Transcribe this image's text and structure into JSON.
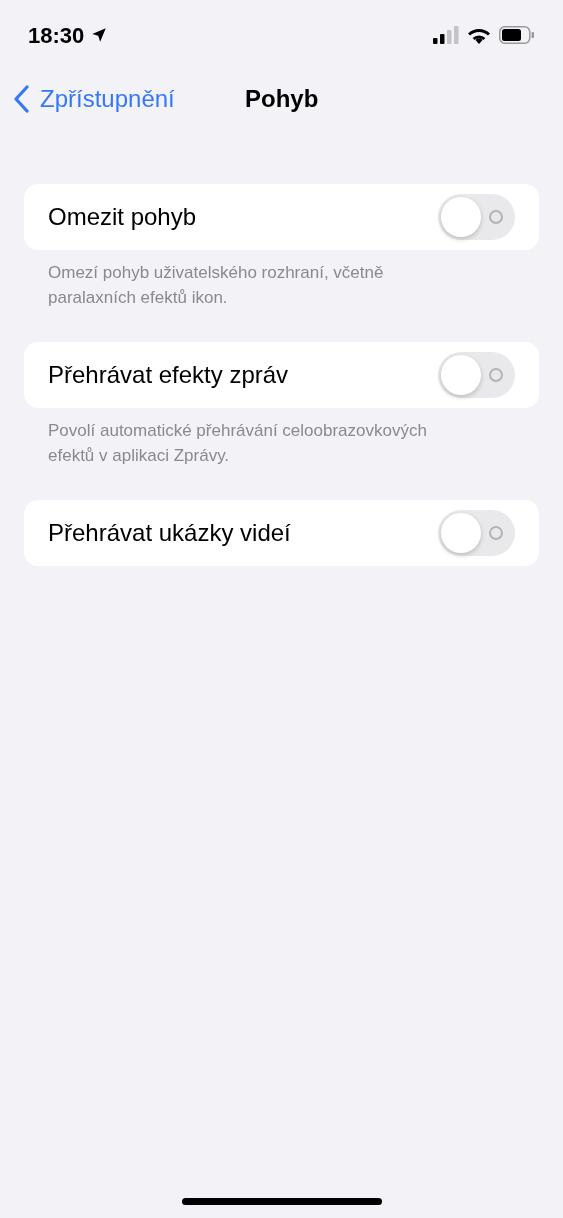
{
  "status_bar": {
    "time": "18:30"
  },
  "nav": {
    "back_label": "Zpřístupnění",
    "title": "Pohyb"
  },
  "groups": [
    {
      "label": "Omezit pohyb",
      "on": false,
      "footer": "Omezí pohyb uživatelského rozhraní, včetně paralaxních efektů ikon."
    },
    {
      "label": "Přehrávat efekty zpráv",
      "on": false,
      "footer": "Povolí automatické přehrávání celoobrazovkových efektů v aplikaci Zprávy."
    },
    {
      "label": "Přehrávat ukázky videí",
      "on": false
    }
  ]
}
